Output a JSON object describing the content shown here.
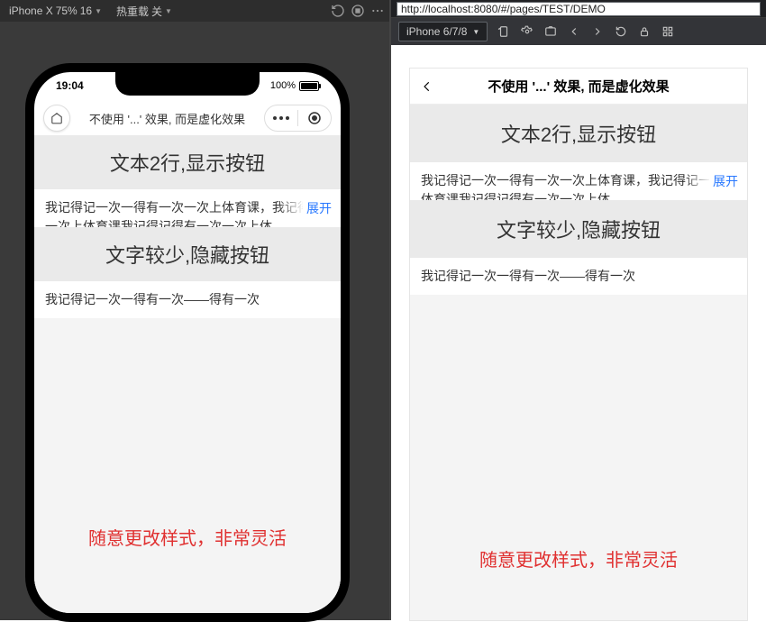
{
  "left_toolbar": {
    "device": "iPhone X",
    "zoom": "75%",
    "font_size": "16",
    "hot_reload_label": "热重载",
    "hot_reload_state": "关"
  },
  "right_toolbar": {
    "url": "http://localhost:8080/#/pages/TEST/DEMO",
    "device": "iPhone 6/7/8"
  },
  "status_bar": {
    "time": "19:04",
    "battery_pct": "100%"
  },
  "page_title": "不使用 '...' 效果, 而是虚化效果",
  "sections": {
    "s1_heading": "文本2行,显示按钮",
    "s1_body": "我记得记一次一得有一次一次上体育课，我记得记一次上体育课我记得记得有一次一次上体",
    "expand_label": "展开",
    "s2_heading": "文字较少,隐藏按钮",
    "s2_body": "我记得记一次一得有一次——得有一次"
  },
  "footer_note": "随意更改样式，非常灵活"
}
